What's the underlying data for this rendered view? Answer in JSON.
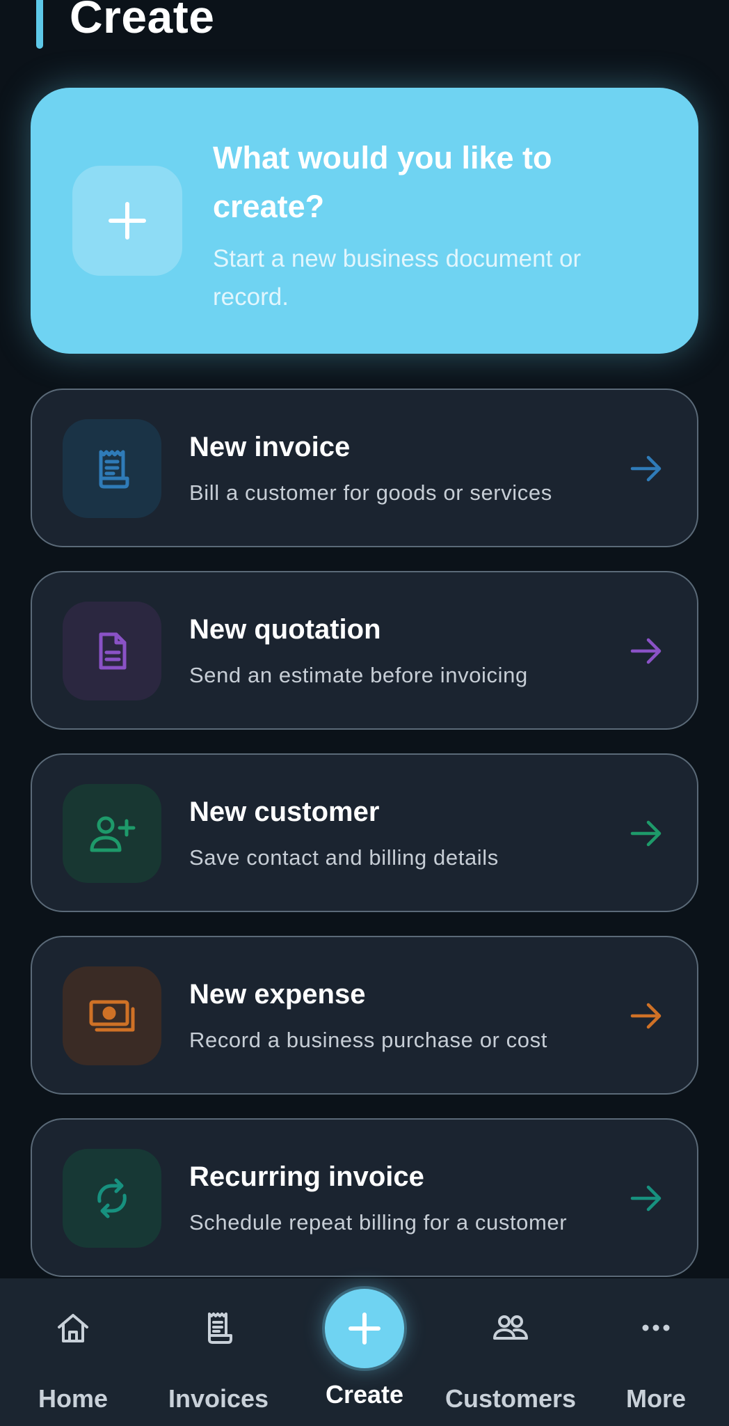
{
  "header": {
    "title": "Create",
    "accent_color": "#5ec8e8"
  },
  "hero": {
    "icon": "plus-icon",
    "title": "What would you like to create?",
    "subtitle": "Start a new business document or record.",
    "background_color": "#6fd3f2"
  },
  "items": [
    {
      "title": "New invoice",
      "subtitle": "Bill a customer for goods or services",
      "icon": "receipt-icon",
      "color": "#2f7bb8",
      "icon_bg": "#1a3346"
    },
    {
      "title": "New quotation",
      "subtitle": "Send an estimate before invoicing",
      "icon": "document-icon",
      "color": "#8a52c6",
      "icon_bg": "#2b2740"
    },
    {
      "title": "New customer",
      "subtitle": "Save contact and billing details",
      "icon": "user-plus-icon",
      "color": "#1e9a6a",
      "icon_bg": "#183732"
    },
    {
      "title": "New expense",
      "subtitle": "Record a business purchase or cost",
      "icon": "cash-icon",
      "color": "#cf7126",
      "icon_bg": "#3a2b25"
    },
    {
      "title": "Recurring invoice",
      "subtitle": "Schedule repeat billing for a customer",
      "icon": "refresh-icon",
      "color": "#17917f",
      "icon_bg": "#173835"
    }
  ],
  "nav": {
    "home": {
      "label": "Home",
      "icon": "home-icon"
    },
    "invoices": {
      "label": "Invoices",
      "icon": "receipt-icon"
    },
    "create": {
      "label": "Create",
      "icon": "plus-icon"
    },
    "customers": {
      "label": "Customers",
      "icon": "users-icon"
    },
    "more": {
      "label": "More",
      "icon": "more-dots-icon"
    }
  }
}
